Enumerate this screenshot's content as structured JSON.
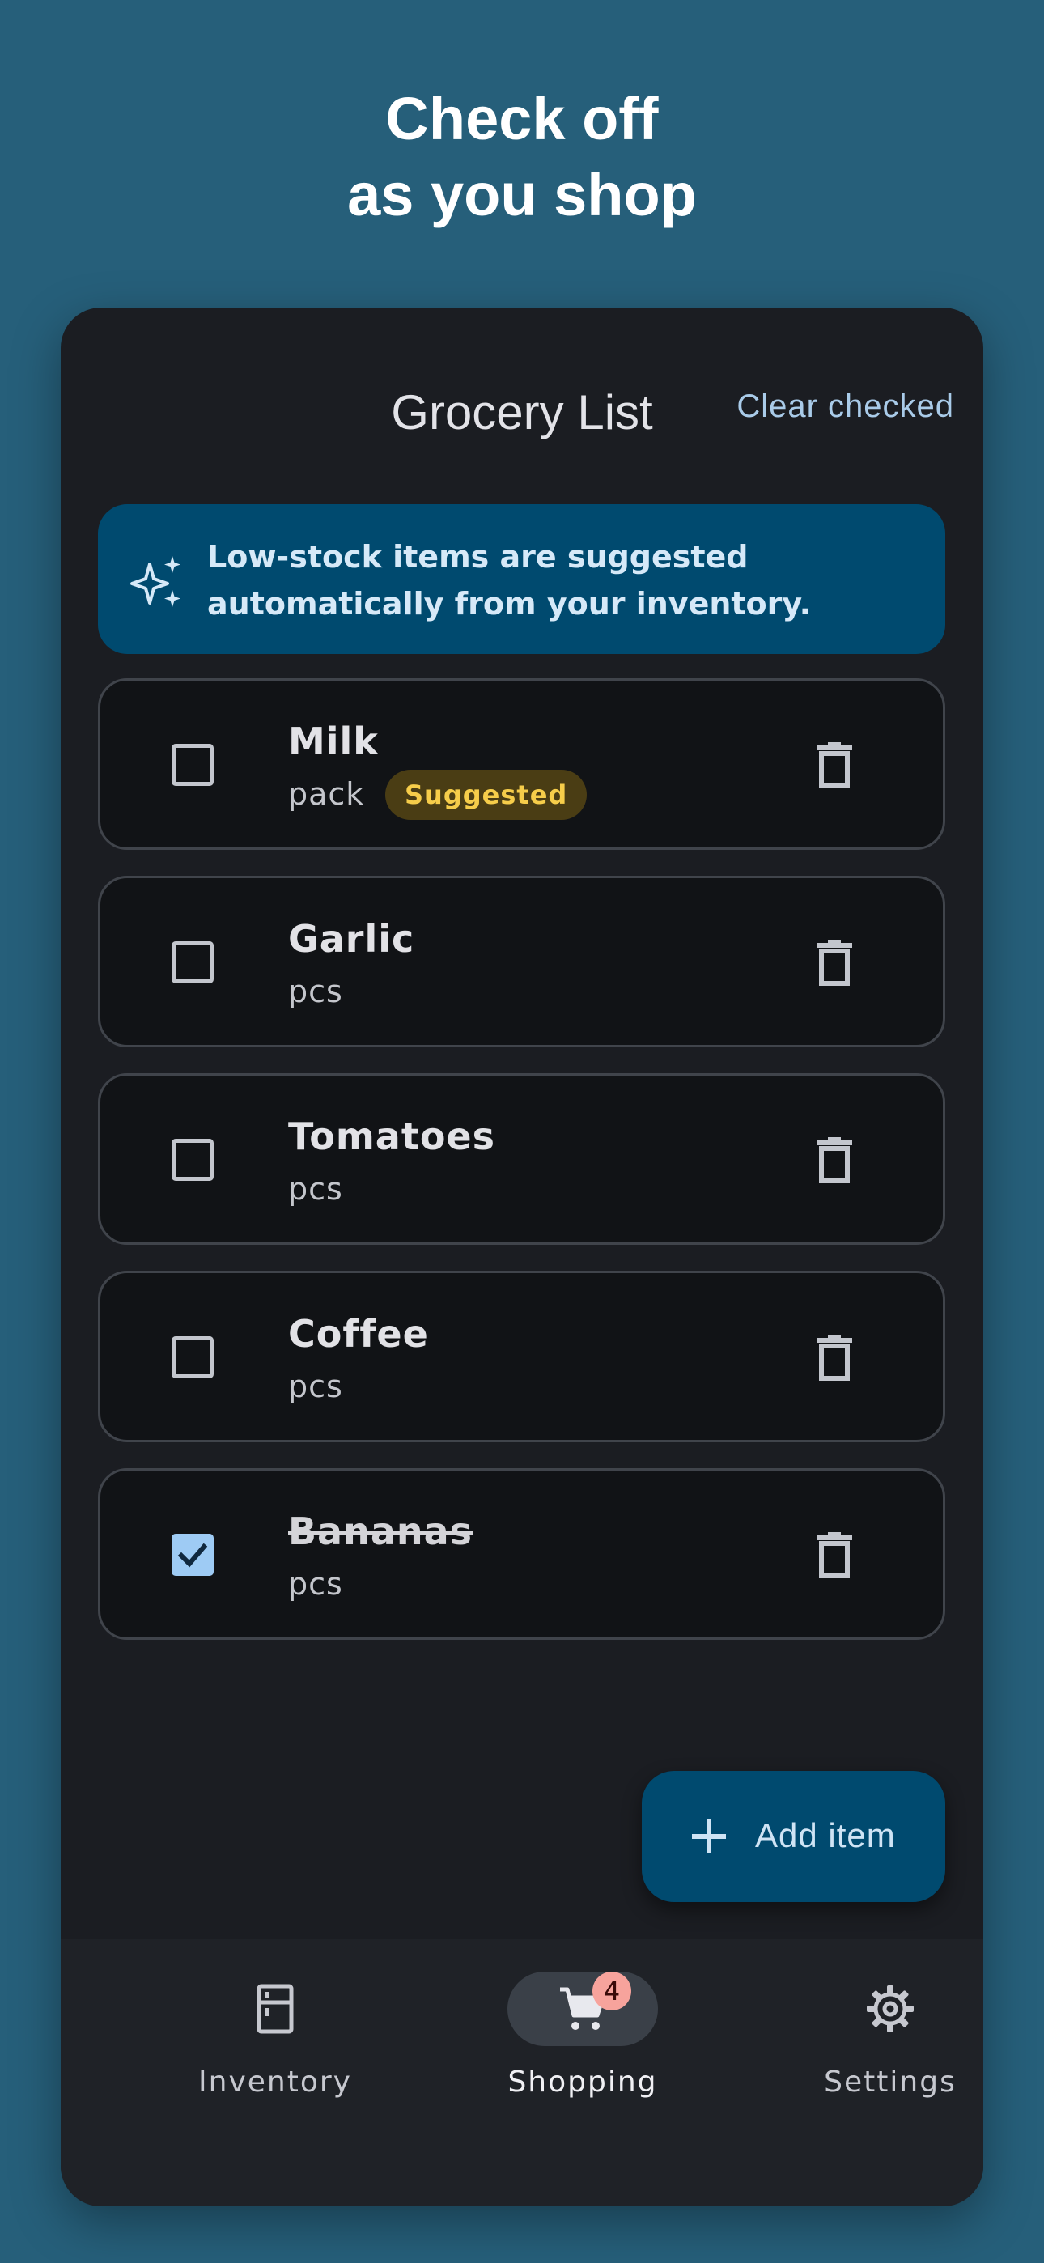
{
  "promo": {
    "line1": "Check off",
    "line2": "as you shop"
  },
  "header": {
    "title": "Grocery List",
    "clear_label": "Clear checked"
  },
  "banner": {
    "icon": "sparkle-icon",
    "text": "Low-stock items are suggested automatically from your inventory."
  },
  "items": [
    {
      "name": "Milk",
      "unit": "pack",
      "badge": "Suggested",
      "checked": false
    },
    {
      "name": "Garlic",
      "unit": "pcs",
      "checked": false
    },
    {
      "name": "Tomatoes",
      "unit": "pcs",
      "checked": false
    },
    {
      "name": "Coffee",
      "unit": "pcs",
      "checked": false
    },
    {
      "name": "Bananas",
      "unit": "pcs",
      "checked": true
    }
  ],
  "fab": {
    "label": "Add item",
    "icon": "plus-icon"
  },
  "nav": {
    "items": [
      {
        "label": "Inventory",
        "icon": "fridge-icon",
        "active": false
      },
      {
        "label": "Shopping",
        "icon": "cart-icon",
        "active": true,
        "badge": "4"
      },
      {
        "label": "Settings",
        "icon": "gear-icon",
        "active": false
      }
    ]
  },
  "colors": {
    "background": "#265f7a",
    "surface": "#1b1d22",
    "accent": "#004a6f",
    "accent_text": "#a9cbe9",
    "suggested_badge": "#f6cd4a",
    "cart_badge": "#f7a39c"
  }
}
